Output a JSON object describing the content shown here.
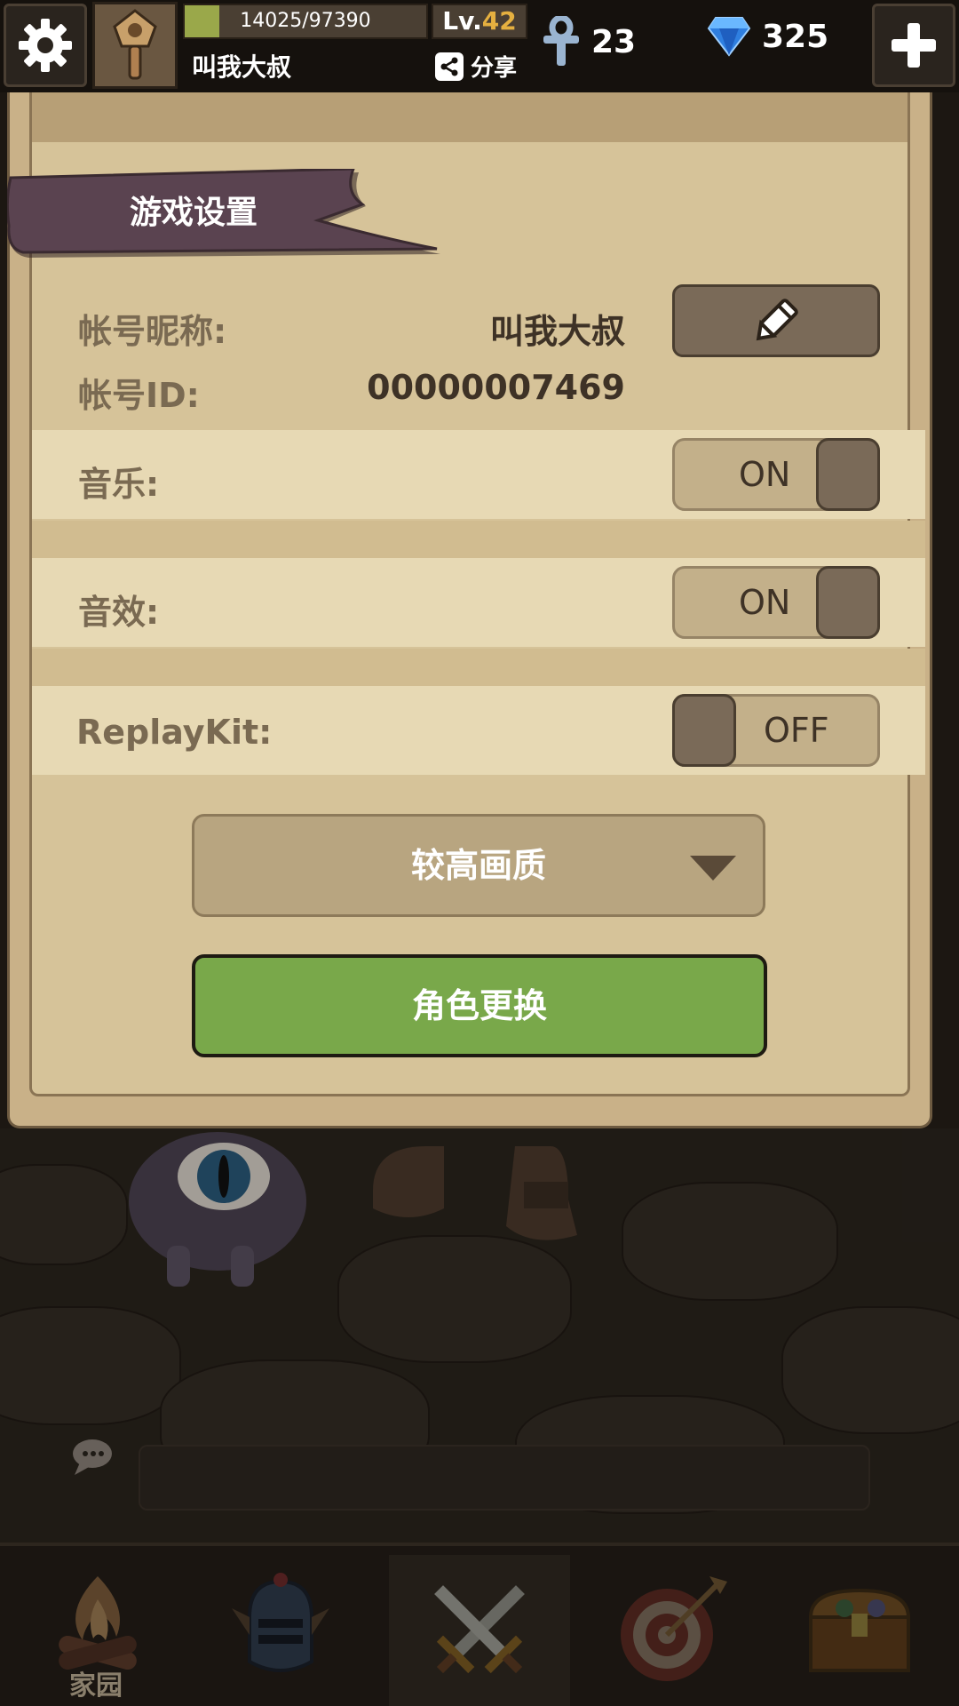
{
  "topbar": {
    "xp_text": "14025/97390",
    "xp_progress": 0.144,
    "level_prefix": "Lv.",
    "level_num": "42",
    "player_name": "叫我大叔",
    "share_label": "分享",
    "ankh_count": "23",
    "gem_count": "325"
  },
  "settings": {
    "title": "游戏设置",
    "nickname_label": "帐号昵称:",
    "nickname_value": "叫我大叔",
    "id_label": "帐号ID:",
    "id_value": "00000007469",
    "music_label": "音乐:",
    "music_state": "ON",
    "sfx_label": "音效:",
    "sfx_state": "ON",
    "replay_label": "ReplayKit:",
    "replay_state": "OFF",
    "quality_value": "较高画质",
    "role_button": "角色更换"
  },
  "bottom_nav": {
    "home_label": "家园"
  },
  "colors": {
    "accent_green": "#79a84a",
    "gold": "#e5b040",
    "panel": "#d6c399"
  }
}
